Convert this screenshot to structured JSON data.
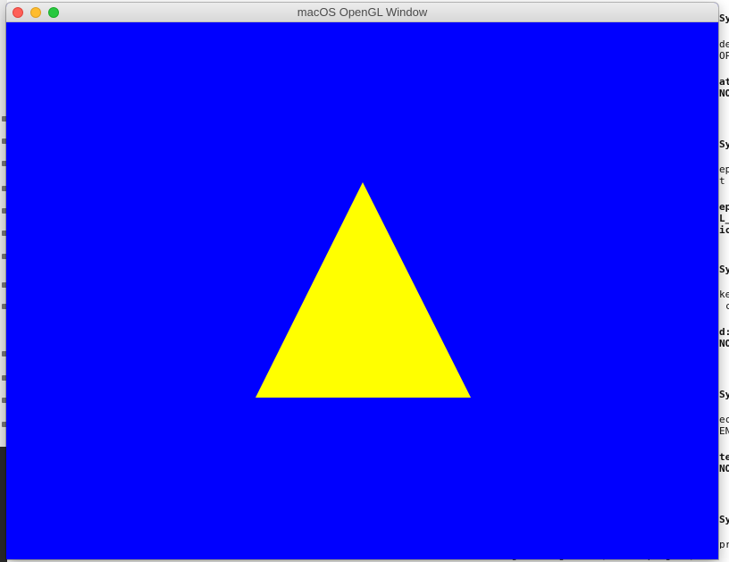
{
  "window": {
    "title": "macOS OpenGL Window"
  },
  "scene": {
    "clear_color": "#0000ff",
    "shape": "triangle",
    "shape_color": "#ffff00"
  },
  "background_doc": {
    "right_fragments": [
      "Sy",
      "de",
      "OP",
      "at",
      "NO",
      "Sy",
      "ep",
      "t",
      "ep",
      "L_",
      "ic",
      "Sy",
      "ke",
      "c",
      "d:",
      "NO",
      "Sy",
      "ec",
      "EN",
      "te",
      "NO",
      "Sy",
      "pr"
    ],
    "bottom_fragment": "GLAPI void APIENTRY glGetProgramiv (GLuint program, GL"
  },
  "colors": {
    "close": "#fe5f57",
    "minimize": "#febc2e",
    "zoom": "#28c840"
  }
}
